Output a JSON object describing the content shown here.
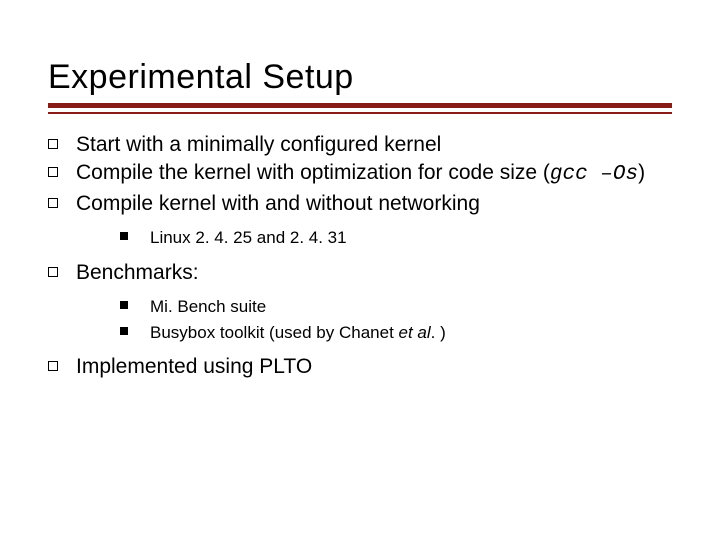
{
  "slide": {
    "title": "Experimental Setup",
    "bullets": {
      "b1": "Start with a minimally configured kernel",
      "b2_pre": "Compile the kernel with optimization for code size (",
      "b2_code": "gcc –Os",
      "b2_post": ")",
      "b3": "Compile kernel with and without networking",
      "b3_sub1": "Linux 2. 4. 25 and 2. 4. 31",
      "b4": "Benchmarks:",
      "b4_sub1": "Mi. Bench suite",
      "b4_sub2_pre": "Busybox toolkit (used by Chanet ",
      "b4_sub2_em": "et al",
      "b4_sub2_post": ". )",
      "b5": "Implemented using PLTO"
    }
  }
}
